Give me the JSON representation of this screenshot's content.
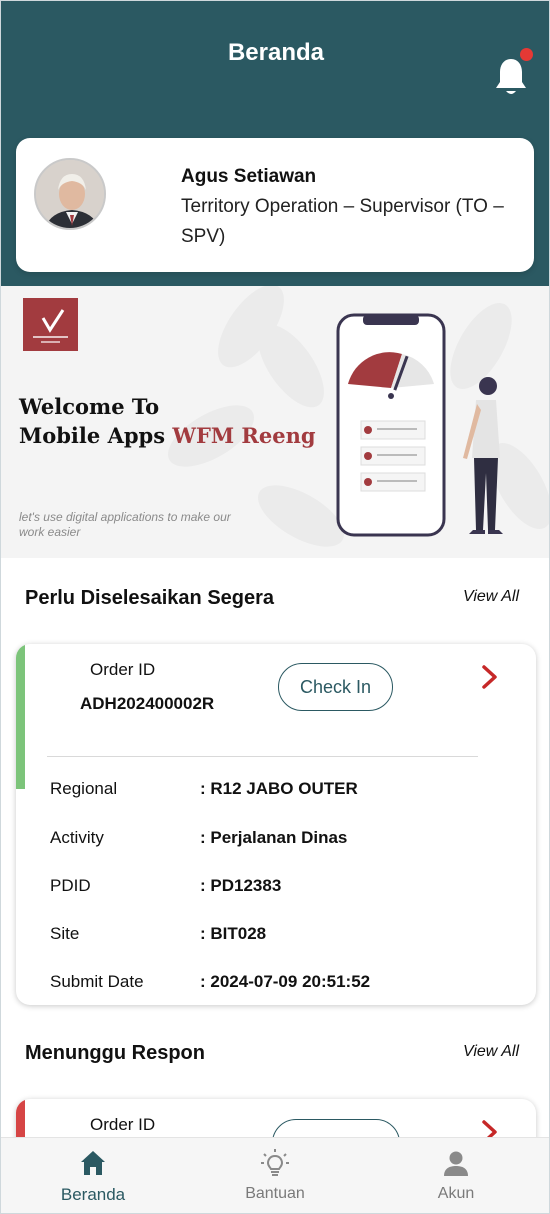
{
  "header": {
    "title": "Beranda",
    "notification_badge": true
  },
  "profile": {
    "name": "Agus Setiawan",
    "role": "Territory Operation – Supervisor (TO – SPV)"
  },
  "banner": {
    "welcome_line1": "Welcome To",
    "welcome_line2_prefix": "Mobile Apps ",
    "welcome_line2_accent": "WFM Reeng",
    "tagline": "let's use digital applications to make our work easier"
  },
  "urgent": {
    "title": "Perlu Diselesaikan Segera",
    "view_all": "View All",
    "order": {
      "id_label": "Order ID",
      "id_value": "ADH202400002R",
      "action_label": "Check In",
      "status_color": "#7cc47a",
      "rows": [
        {
          "label": "Regional",
          "value": ": R12 JABO OUTER"
        },
        {
          "label": "Activity",
          "value": ": Perjalanan Dinas"
        },
        {
          "label": "PDID",
          "value": ": PD12383"
        },
        {
          "label": "Site",
          "value": ": BIT028"
        },
        {
          "label": "Submit Date",
          "value": ": 2024-07-09 20:51:52"
        }
      ]
    }
  },
  "waiting": {
    "title": "Menunggu Respon",
    "view_all": "View All",
    "order": {
      "id_label": "Order ID",
      "status_color": "#d64545"
    }
  },
  "nav": {
    "items": [
      {
        "label": "Beranda",
        "icon": "home-icon",
        "active": true
      },
      {
        "label": "Bantuan",
        "icon": "lightbulb-icon",
        "active": false
      },
      {
        "label": "Akun",
        "icon": "person-icon",
        "active": false
      }
    ]
  },
  "colors": {
    "primary": "#2b5962",
    "accent": "#a23b3f",
    "badge": "#e53935"
  }
}
